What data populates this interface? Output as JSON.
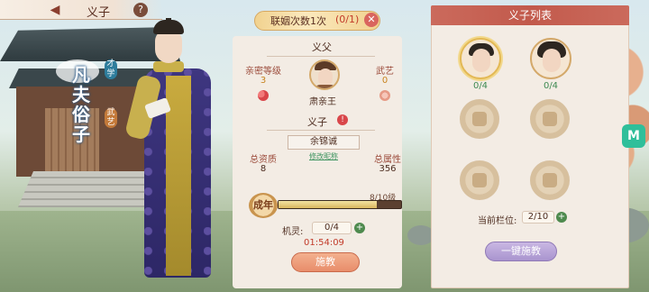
{
  "header": {
    "title": "义子",
    "back_glyph": "◀",
    "help_glyph": "?"
  },
  "character": {
    "name_vertical": "凡夫俗子",
    "tag_talent": "才学",
    "tag_art": "武艺"
  },
  "marriage": {
    "label": "联姻次数1次",
    "count": "(0/1)",
    "close_glyph": "✕"
  },
  "father": {
    "section_title": "义父",
    "intimacy_label": "亲密等级",
    "intimacy_value": "3",
    "martial_label": "武艺",
    "martial_value": "0",
    "name": "肃亲王"
  },
  "child": {
    "section_title": "义子",
    "alert_glyph": "!",
    "name": "余锦诚",
    "rename_link": "修改昵称",
    "aptitude_label": "总资质",
    "aptitude_value": "8",
    "attribute_label": "总属性",
    "attribute_value": "356",
    "stage": "成年",
    "level": "8/10级",
    "level_progress": 0.8,
    "wit_label": "机灵:",
    "wit_value": "0/4",
    "timer": "01:54:09",
    "teach_button": "施教",
    "plus_glyph": "+"
  },
  "list": {
    "title": "义子列表",
    "slots": [
      {
        "count": "0/4"
      },
      {
        "count": "0/4"
      }
    ],
    "current_slot_label": "当前栏位:",
    "current_slot_value": "2/10",
    "one_key_button": "一键施教",
    "plus_glyph": "+"
  },
  "side": {
    "logo": "M"
  },
  "colors": {
    "accent_red": "#c25a4c",
    "teach_orange": "#e88d6b",
    "one_key_purple": "#a994cf",
    "progress_gold": "#d9b65e"
  },
  "icons": [
    "back-icon",
    "help-icon",
    "close-icon",
    "heart-icon",
    "art-icon",
    "plus-icon",
    "alert-icon"
  ]
}
